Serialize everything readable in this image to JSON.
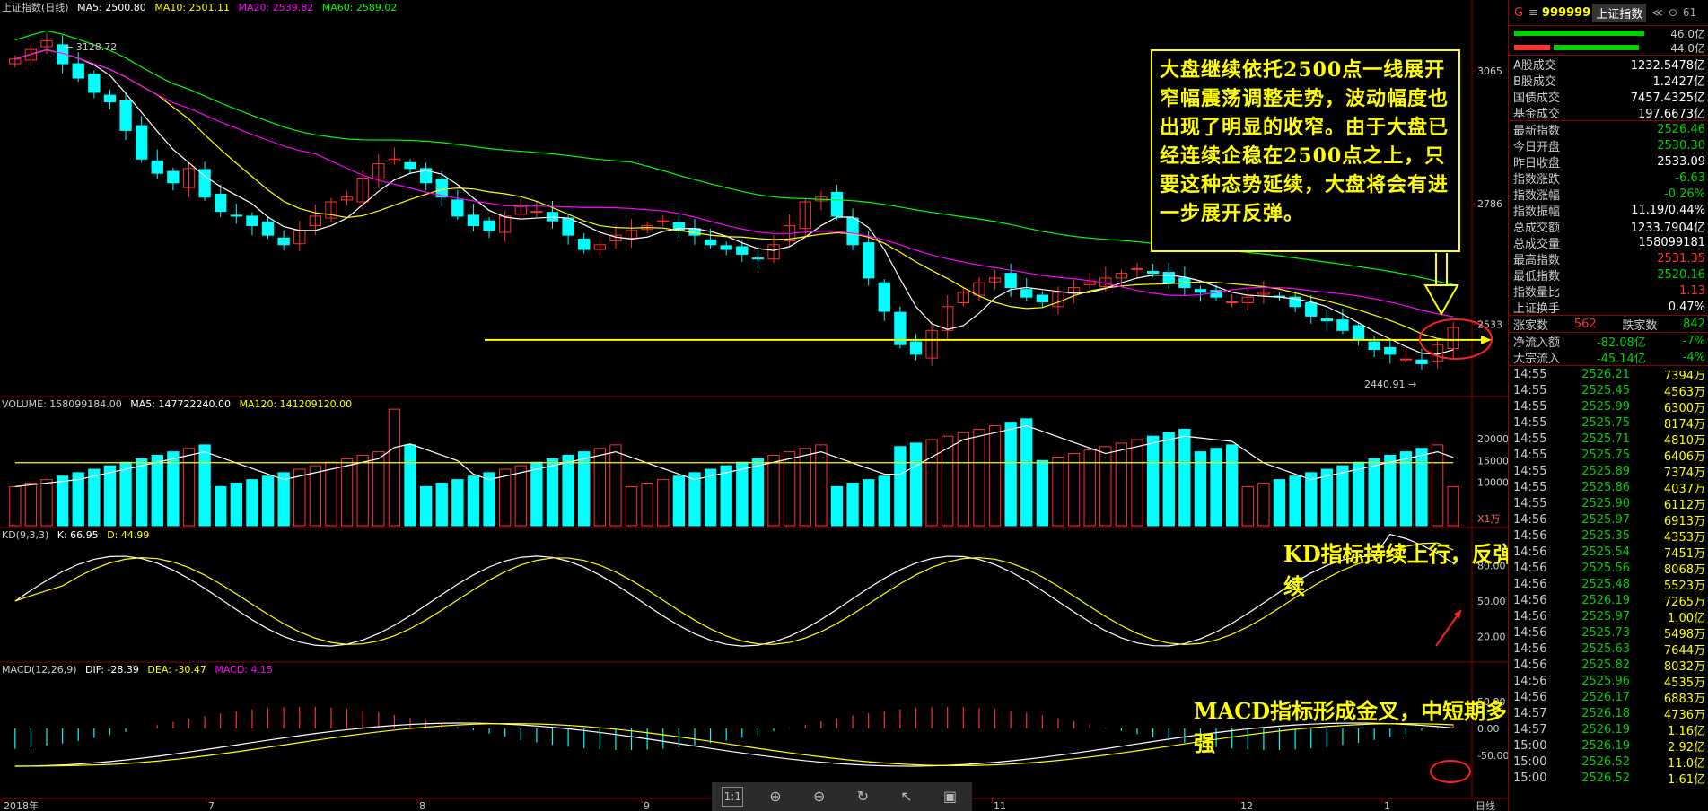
{
  "main": {
    "title": "上证指数(日线)",
    "ma": [
      {
        "label": "MA5: 2500.80",
        "color": "#ffffff"
      },
      {
        "label": "MA10: 2501.11",
        "color": "#ffff00"
      },
      {
        "label": "MA20: 2539.82",
        "color": "#ff00ff"
      },
      {
        "label": "MA60: 2589.02",
        "color": "#00ff00"
      }
    ],
    "high_label": "3128.72",
    "low_label": "2440.91",
    "y_ticks": [
      "3065",
      "2786",
      "2533"
    ],
    "callout": "大盘继续依托2500点一线展开窄幅震荡调整走势，波动幅度也出现了明显的收窄。由于大盘已经连续企稳在2500点之上，只要这种态势延续，大盘将会有进一步展开反弹。"
  },
  "volume": {
    "title": "VOLUME: 158099184.00",
    "ma": [
      {
        "label": "MA5: 147722240.00",
        "color": "#ffffff"
      },
      {
        "label": "MA120: 141209120.00",
        "color": "#ffff00"
      }
    ],
    "y_ticks": [
      "20000",
      "15000",
      "10000"
    ],
    "unit": "X1万"
  },
  "kd": {
    "title": "KD(9,3,3)",
    "k_label": "K: 66.95",
    "d_label": "D: 44.99",
    "y_ticks": [
      "80.00",
      "50.00",
      "20.00"
    ],
    "note": "KD指标持续上行，反弹格局仍然延续"
  },
  "macd": {
    "title": "MACD(12,26,9)",
    "dif_label": "DIF: -28.39",
    "dea_label": "DEA: -30.47",
    "macd_label": "MACD: 4.15",
    "y_ticks": [
      "50.00",
      "0.00",
      "-50.00"
    ],
    "note": "MACD指标形成金叉，中短期多头力量转强"
  },
  "x_axis": {
    "labels": [
      "2018年",
      "7",
      "8",
      "9",
      "11",
      "12",
      "1"
    ],
    "period": "日线"
  },
  "toolbar": {
    "icons": [
      "1:1",
      "zoom-in",
      "zoom-out",
      "refresh",
      "cursor",
      "save"
    ],
    "one_to_one": "1:1"
  },
  "sidebar": {
    "code_prefix": "G",
    "menu": "≡",
    "code": "999999",
    "name": "上证指数",
    "btns": [
      "≪",
      "⊙",
      "61"
    ],
    "bar1": {
      "value": "46.0亿",
      "color": "#00d000"
    },
    "bar2": {
      "value": "44.0亿",
      "color": "#ff3030"
    },
    "volumes": [
      {
        "label": "A股成交",
        "value": "1232.5478亿"
      },
      {
        "label": "B股成交",
        "value": "1.2427亿"
      },
      {
        "label": "国债成交",
        "value": "7457.4325亿"
      },
      {
        "label": "基金成交",
        "value": "197.6673亿"
      }
    ],
    "stats": [
      {
        "label": "最新指数",
        "value": "2526.46",
        "color": "#00d000"
      },
      {
        "label": "今日开盘",
        "value": "2530.30",
        "color": "#00d000"
      },
      {
        "label": "昨日收盘",
        "value": "2533.09",
        "color": "#ffffff"
      },
      {
        "label": "指数涨跌",
        "value": "-6.63",
        "color": "#00d000"
      },
      {
        "label": "指数涨幅",
        "value": "-0.26%",
        "color": "#00d000"
      },
      {
        "label": "指数振幅",
        "value": "11.19/0.44%",
        "color": "#ffffff"
      },
      {
        "label": "总成交额",
        "value": "1233.7904亿",
        "color": "#ffffff"
      },
      {
        "label": "总成交量",
        "value": "158099181",
        "color": "#ffffff"
      },
      {
        "label": "最高指数",
        "value": "2531.35",
        "color": "#ff3030"
      },
      {
        "label": "最低指数",
        "value": "2520.16",
        "color": "#00d000"
      },
      {
        "label": "指数量比",
        "value": "1.13",
        "color": "#ff3030"
      },
      {
        "label": "上证换手",
        "value": "0.47%",
        "color": "#ffffff"
      }
    ],
    "updown": {
      "up_label": "涨家数",
      "up": "562",
      "down_label": "跌家数",
      "down": "842"
    },
    "flows": [
      {
        "label": "净流入额",
        "value": "-82.08亿",
        "pct": "-7%"
      },
      {
        "label": "大宗流入",
        "value": "-45.14亿",
        "pct": "-4%"
      }
    ],
    "ticks": [
      {
        "t": "14:55",
        "p": "2526.21",
        "v": "7394万"
      },
      {
        "t": "14:55",
        "p": "2525.45",
        "v": "4563万"
      },
      {
        "t": "14:55",
        "p": "2525.99",
        "v": "6300万"
      },
      {
        "t": "14:55",
        "p": "2525.75",
        "v": "8174万"
      },
      {
        "t": "14:55",
        "p": "2525.71",
        "v": "4810万"
      },
      {
        "t": "14:55",
        "p": "2525.75",
        "v": "6406万"
      },
      {
        "t": "14:55",
        "p": "2525.89",
        "v": "7374万"
      },
      {
        "t": "14:55",
        "p": "2525.86",
        "v": "4037万"
      },
      {
        "t": "14:55",
        "p": "2525.90",
        "v": "6112万"
      },
      {
        "t": "14:56",
        "p": "2525.97",
        "v": "6913万"
      },
      {
        "t": "14:56",
        "p": "2525.35",
        "v": "4353万"
      },
      {
        "t": "14:56",
        "p": "2525.54",
        "v": "7451万"
      },
      {
        "t": "14:56",
        "p": "2525.56",
        "v": "8068万"
      },
      {
        "t": "14:56",
        "p": "2525.48",
        "v": "5523万"
      },
      {
        "t": "14:56",
        "p": "2526.19",
        "v": "7265万"
      },
      {
        "t": "14:56",
        "p": "2525.97",
        "v": "1.00亿"
      },
      {
        "t": "14:56",
        "p": "2525.73",
        "v": "5498万"
      },
      {
        "t": "14:56",
        "p": "2525.63",
        "v": "7644万"
      },
      {
        "t": "14:56",
        "p": "2525.82",
        "v": "8032万"
      },
      {
        "t": "14:56",
        "p": "2525.96",
        "v": "4535万"
      },
      {
        "t": "14:56",
        "p": "2526.17",
        "v": "6883万"
      },
      {
        "t": "14:57",
        "p": "2526.18",
        "v": "4736万"
      },
      {
        "t": "14:57",
        "p": "2526.19",
        "v": "1.16亿"
      },
      {
        "t": "15:00",
        "p": "2526.19",
        "v": "2.92亿"
      },
      {
        "t": "15:00",
        "p": "2526.52",
        "v": "11.0亿"
      },
      {
        "t": "15:00",
        "p": "2526.52",
        "v": "1.61亿"
      }
    ]
  },
  "chart_data": {
    "type": "candlestick",
    "title": "上证指数(日线)",
    "y_ticks": [
      3065,
      2786,
      2533
    ],
    "support_line": 2500,
    "high": 3128.72,
    "low": 2440.91,
    "x_labels": [
      "2018年",
      "7",
      "8",
      "9",
      "11",
      "12",
      "1"
    ],
    "close_series": [
      3090,
      3110,
      3128,
      3080,
      3050,
      3020,
      3000,
      2940,
      2880,
      2850,
      2830,
      2860,
      2800,
      2770,
      2760,
      2740,
      2720,
      2700,
      2730,
      2760,
      2790,
      2800,
      2840,
      2870,
      2880,
      2860,
      2830,
      2800,
      2760,
      2740,
      2730,
      2760,
      2780,
      2770,
      2750,
      2720,
      2690,
      2700,
      2720,
      2730,
      2740,
      2750,
      2730,
      2720,
      2700,
      2690,
      2680,
      2670,
      2700,
      2740,
      2790,
      2800,
      2760,
      2700,
      2630,
      2560,
      2490,
      2470,
      2520,
      2570,
      2600,
      2620,
      2630,
      2610,
      2590,
      2580,
      2600,
      2610,
      2620,
      2630,
      2640,
      2650,
      2640,
      2620,
      2610,
      2600,
      2590,
      2580,
      2590,
      2600,
      2590,
      2570,
      2550,
      2540,
      2520,
      2500,
      2480,
      2470,
      2460,
      2450,
      2490,
      2526
    ]
  }
}
